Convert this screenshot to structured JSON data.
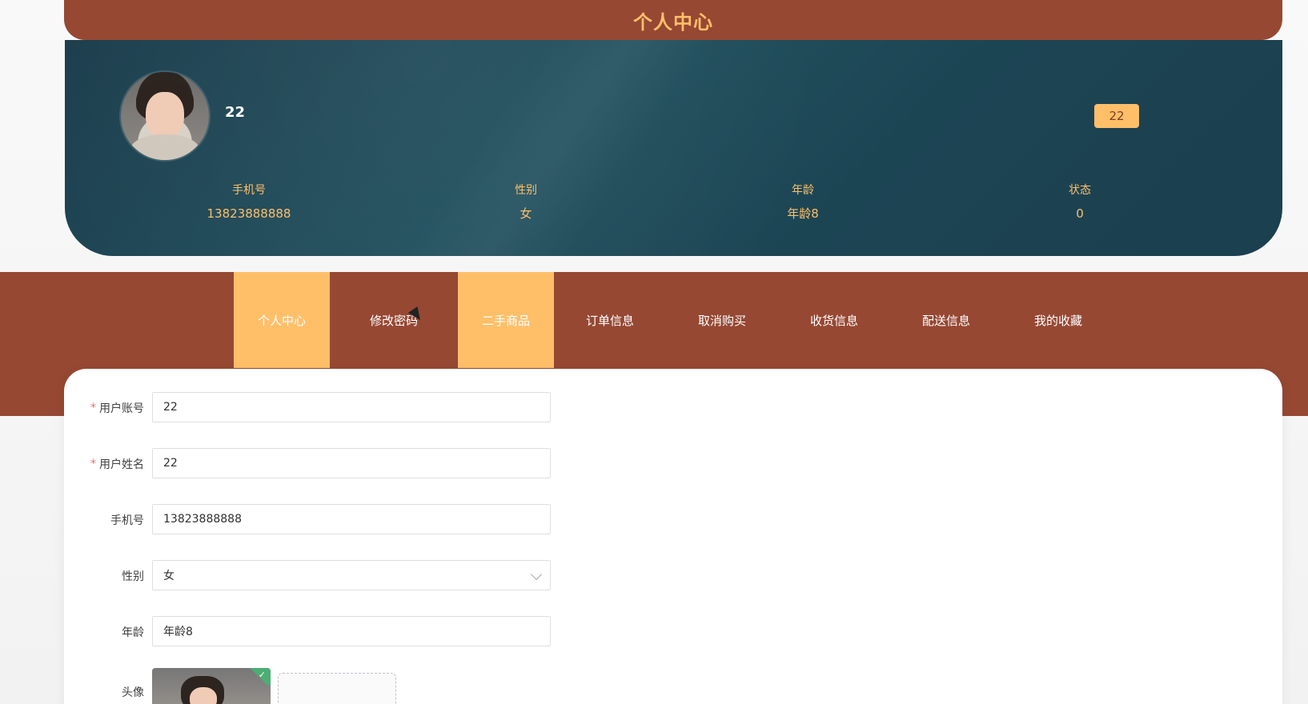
{
  "header": {
    "title": "个人中心"
  },
  "profile": {
    "name": "22",
    "badge": "22",
    "stats": [
      {
        "label": "手机号",
        "value": "13823888888"
      },
      {
        "label": "性别",
        "value": "女"
      },
      {
        "label": "年龄",
        "value": "年龄8"
      },
      {
        "label": "状态",
        "value": "0"
      }
    ]
  },
  "nav": {
    "items": [
      {
        "label": "个人中心",
        "active": true
      },
      {
        "label": "修改密码",
        "active": false
      },
      {
        "label": "二手商品",
        "active": true
      },
      {
        "label": "订单信息",
        "active": false
      },
      {
        "label": "取消购买",
        "active": false
      },
      {
        "label": "收货信息",
        "active": false
      },
      {
        "label": "配送信息",
        "active": false
      },
      {
        "label": "我的收藏",
        "active": false
      }
    ]
  },
  "form": {
    "fields": [
      {
        "label": "用户账号",
        "required": "*",
        "value": "22"
      },
      {
        "label": "用户姓名",
        "required": "*",
        "value": "22"
      },
      {
        "label": "手机号",
        "required": "",
        "value": "13823888888"
      },
      {
        "label": "性别",
        "required": "",
        "value": "女"
      },
      {
        "label": "年龄",
        "required": "",
        "value": "年龄8"
      }
    ],
    "avatar_label": "头像"
  },
  "theme": {
    "primary": "#964833",
    "accent": "#ffbf69",
    "profile_bg": "#1e4655",
    "success": "#4cae73"
  },
  "icons": {
    "avatar": "user-avatar-icon",
    "select": "chevron-down-icon",
    "upload_success": "check-icon",
    "cursor": "mouse-pointer-icon"
  }
}
